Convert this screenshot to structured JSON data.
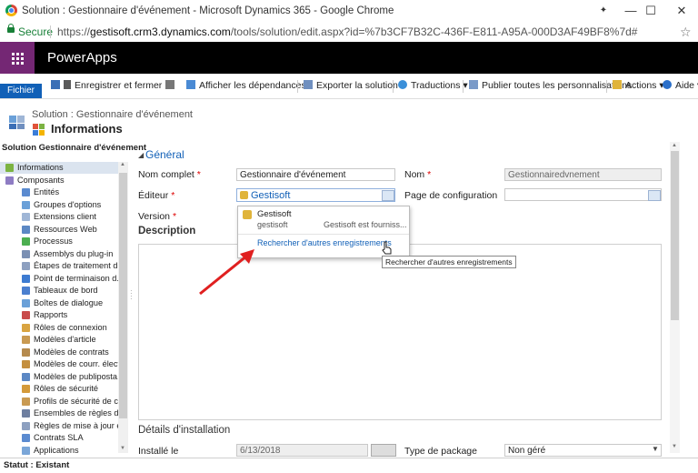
{
  "browser": {
    "window_title": "Solution : Gestionnaire d'événement - Microsoft Dynamics 365 - Google Chrome",
    "secure_label": "Secure",
    "url_prefix": "https://",
    "url_host": "gestisoft.crm3.dynamics.com",
    "url_path": "/tools/solution/edit.aspx?id=%7b3CF7B32C-436F-E811-A95A-000D3AF49BF8%7d#",
    "minimize_glyph": "—",
    "maximize_glyph": "☐",
    "close_glyph": "✕",
    "back_glyph": "✦"
  },
  "app": {
    "name": "PowerApps"
  },
  "ribbon": {
    "file_tab": "Fichier",
    "save_close": "Enregistrer et fermer",
    "show_dependencies": "Afficher les dépendances",
    "export_solution": "Exporter la solution",
    "translations": "Traductions ▾",
    "publish_all": "Publier toutes les personnalisations",
    "actions": "Actions ▾",
    "help": "Aide ▾"
  },
  "header": {
    "breadcrumb": "Solution : Gestionnaire d'événement",
    "title": "Informations"
  },
  "nav": {
    "title": "Solution Gestionnaire d'événement",
    "items": [
      {
        "label": "Informations",
        "color": "#7cb342"
      },
      {
        "label": "Composants",
        "color": "#8e7cc3"
      },
      {
        "label": "Entités",
        "color": "#5b8bd0"
      },
      {
        "label": "Groupes d'options",
        "color": "#6aa0d8"
      },
      {
        "label": "Extensions client",
        "color": "#9fb6d6"
      },
      {
        "label": "Ressources Web",
        "color": "#5c88c4"
      },
      {
        "label": "Processus",
        "color": "#4caf50"
      },
      {
        "label": "Assemblys du plug-in",
        "color": "#7a8fb3"
      },
      {
        "label": "Étapes de traitement d...",
        "color": "#8da0c0"
      },
      {
        "label": "Point de terminaison d...",
        "color": "#3d7bd1"
      },
      {
        "label": "Tableaux de bord",
        "color": "#4b7fcf"
      },
      {
        "label": "Boîtes de dialogue",
        "color": "#6aa0d8"
      },
      {
        "label": "Rapports",
        "color": "#c94b4b"
      },
      {
        "label": "Rôles de connexion",
        "color": "#d9a441"
      },
      {
        "label": "Modèles d'article",
        "color": "#c99a52"
      },
      {
        "label": "Modèles de contrats",
        "color": "#b58a4d"
      },
      {
        "label": "Modèles de courr. électr.",
        "color": "#c48f3f"
      },
      {
        "label": "Modèles de publiposta...",
        "color": "#5c88c4"
      },
      {
        "label": "Rôles de sécurité",
        "color": "#d49a3a"
      },
      {
        "label": "Profils de sécurité de c...",
        "color": "#c99a52"
      },
      {
        "label": "Ensembles de règles d'...",
        "color": "#6e7fa0"
      },
      {
        "label": "Règles de mise à jour e...",
        "color": "#8da0c0"
      },
      {
        "label": "Contrats SLA",
        "color": "#5b8bd0"
      },
      {
        "label": "Applications",
        "color": "#7aa6d8"
      }
    ]
  },
  "form": {
    "section_general": "Général",
    "full_name_label": "Nom complet",
    "full_name_value": "Gestionnaire d'événement",
    "name_label": "Nom",
    "name_value": "Gestionnairedvnement",
    "publisher_label": "Éditeur",
    "publisher_value": "Gestisoft",
    "config_page_label": "Page de configuration",
    "config_page_value": "",
    "version_label": "Version",
    "description_label": "Description",
    "required_mark": "*",
    "install_section": "Détails d'installation",
    "installed_on_label": "Installé le",
    "installed_on_value": "6/13/2018",
    "package_type_label": "Type de package",
    "package_type_value": "Non géré"
  },
  "lookup": {
    "result_name": "Gestisoft",
    "result_sub": "gestisoft",
    "result_desc": "Gestisoft est fourniss...",
    "search_more": "Rechercher d'autres enregistrements",
    "tooltip": "Rechercher d'autres enregistrements"
  },
  "status": {
    "text": "Statut : Existant"
  },
  "colors": {
    "accent": "#1160b7",
    "waffle": "#742774",
    "app_header": "#000000",
    "annotation_arrow": "#e02020"
  }
}
